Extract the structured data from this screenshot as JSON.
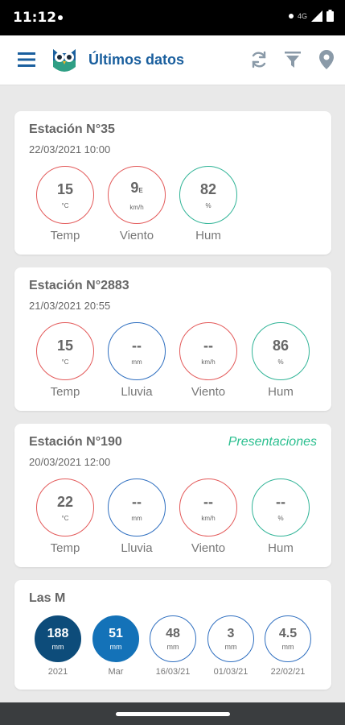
{
  "status_bar": {
    "time": "11:12",
    "network": "4G"
  },
  "app_bar": {
    "title": "Últimos datos",
    "icons": [
      "menu-icon",
      "owl-logo",
      "refresh-icon",
      "filter-icon",
      "location-pin-icon"
    ]
  },
  "stations": [
    {
      "name": "Estación N°35",
      "datetime": "22/03/2021 10:00",
      "link": "",
      "metrics": [
        {
          "value": "15",
          "suffix": "",
          "unit": "°C",
          "label": "Temp",
          "color": "#e35a5a"
        },
        {
          "value": "9",
          "suffix": "E",
          "unit": "km/h",
          "label": "Viento",
          "color": "#e35a5a"
        },
        {
          "value": "82",
          "suffix": "",
          "unit": "%",
          "label": "Hum",
          "color": "#31b497"
        }
      ]
    },
    {
      "name": "Estación N°2883",
      "datetime": "21/03/2021 20:55",
      "link": "",
      "metrics": [
        {
          "value": "15",
          "suffix": "",
          "unit": "°C",
          "label": "Temp",
          "color": "#e35a5a"
        },
        {
          "value": "--",
          "suffix": "",
          "unit": "mm",
          "label": "Lluvia",
          "color": "#2f6fc0"
        },
        {
          "value": "--",
          "suffix": "",
          "unit": "km/h",
          "label": "Viento",
          "color": "#e35a5a"
        },
        {
          "value": "86",
          "suffix": "",
          "unit": "%",
          "label": "Hum",
          "color": "#31b497"
        }
      ]
    },
    {
      "name": "Estación N°190",
      "datetime": "20/03/2021 12:00",
      "link": "Presentaciones",
      "metrics": [
        {
          "value": "22",
          "suffix": "",
          "unit": "°C",
          "label": "Temp",
          "color": "#e35a5a"
        },
        {
          "value": "--",
          "suffix": "",
          "unit": "mm",
          "label": "Lluvia",
          "color": "#2f6fc0"
        },
        {
          "value": "--",
          "suffix": "",
          "unit": "km/h",
          "label": "Viento",
          "color": "#e35a5a"
        },
        {
          "value": "--",
          "suffix": "",
          "unit": "%",
          "label": "Hum",
          "color": "#31b497"
        }
      ]
    }
  ],
  "las_m": {
    "title": "Las M",
    "items": [
      {
        "value": "188",
        "unit": "mm",
        "label": "2021",
        "style": "dark"
      },
      {
        "value": "51",
        "unit": "mm",
        "label": "Mar",
        "style": "mid"
      },
      {
        "value": "48",
        "unit": "mm",
        "label": "16/03/21",
        "style": "outline"
      },
      {
        "value": "3",
        "unit": "mm",
        "label": "01/03/21",
        "style": "outline"
      },
      {
        "value": "4.5",
        "unit": "mm",
        "label": "22/02/21",
        "style": "outline"
      }
    ]
  }
}
